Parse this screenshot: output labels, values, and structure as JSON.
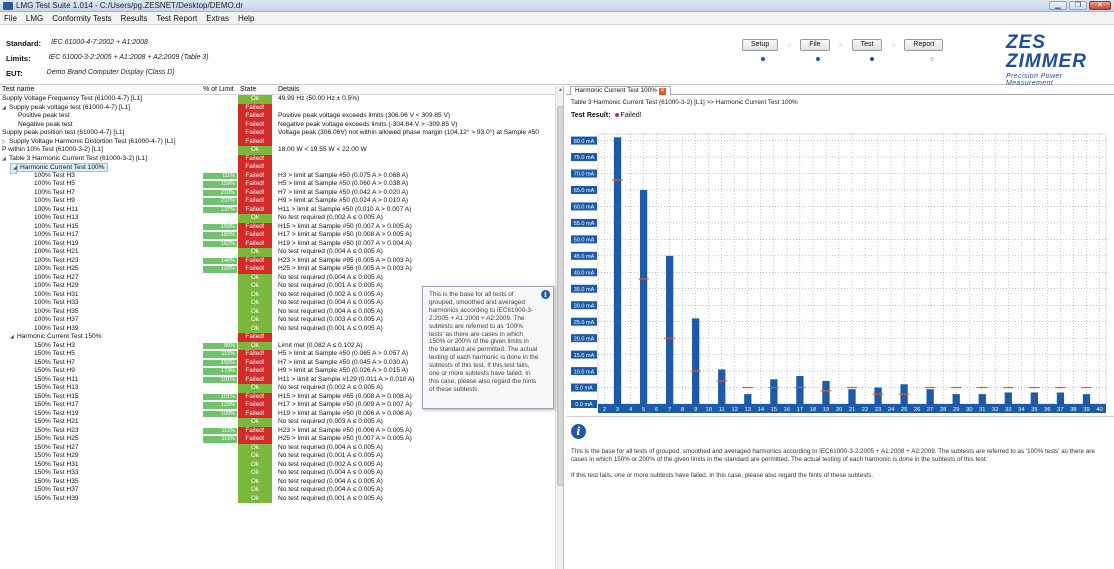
{
  "window": {
    "title": "LMG Test Suite 1.014 - C:/Users/pg.ZESNET/Desktop/DEMO.dr",
    "min": "▁",
    "max": "❐",
    "close": "✕"
  },
  "menu": [
    "File",
    "LMG",
    "Conformity Tests",
    "Results",
    "Test Report",
    "Extras",
    "Help"
  ],
  "header": {
    "standard_label": "Standard:",
    "standard_value": "IEC 61000-4-7:2002 + A1:2008",
    "limits_label": "Limits:",
    "limits_value": "IEC 61000-3-2:2005 + A1:2008 + A2:2009 (Table 3)",
    "eut_label": "EUT:",
    "eut_value": "Demo Brand Computer Display (Class D)"
  },
  "workflow": [
    {
      "label": "Setup",
      "done": true
    },
    {
      "label": "File",
      "done": true
    },
    {
      "label": "Test",
      "done": true
    },
    {
      "label": "Report",
      "done": false
    }
  ],
  "logo": {
    "text": "ZES ZIMMER",
    "subtitle": "Precision Power Measurement"
  },
  "columns": {
    "name": "Test name",
    "limit": "% of Limit",
    "state": "State",
    "details": "Details"
  },
  "rows": [
    {
      "name": "Supply Voltage Frequency Test (61000-4-7) [L1]",
      "indent": 0,
      "state": "Ok",
      "details": "49.99 Hz (50.00 Hz ± 0.5%)"
    },
    {
      "name": "Supply peak voltage test (61000-4-7) [L1]",
      "indent": 0,
      "exp": "◢",
      "state": "Failed!",
      "details": ""
    },
    {
      "name": "Positive peak test",
      "indent": 2,
      "state": "Failed!",
      "details": "Positive peak voltage exceeds limits (306.06 V < 309.85 V)"
    },
    {
      "name": "Negative peak test",
      "indent": 2,
      "state": "Failed!",
      "details": "Negative peak voltage exceeds limits (-304.84 V > -309.85 V)"
    },
    {
      "name": "Supply peak position test (61000-4-7) [L1]",
      "indent": 0,
      "state": "Failed!",
      "details": "Voltage peak (306.06V) not within allowed phase margin (104.12° > 93.0°) at Sample #50"
    },
    {
      "name": "Supply Voltage Harmonic Distortion Test (61000-4-7) [L1]",
      "indent": 0,
      "exp": "▷",
      "state": "Failed!",
      "details": ""
    },
    {
      "name": "P within 10% Test (61000-3-2) [L1]",
      "indent": 0,
      "state": "Ok",
      "details": "18.00 W < 19.55 W < 22.00 W"
    },
    {
      "name": "Table 3 Harmonic Current Test (61000-3-2) [L1]",
      "indent": 0,
      "exp": "◢",
      "state": "Failed!",
      "details": ""
    },
    {
      "name": "Harmonic Current Test 100%",
      "indent": 1,
      "exp": "◢",
      "state": "Failed!",
      "details": "",
      "sel": true
    },
    {
      "name": "100% Test H3",
      "indent": 4,
      "pct": "111%",
      "bw": 34,
      "state": "Failed!",
      "details": "H3 > limit at Sample #50 (0.075 A > 0.068 A)"
    },
    {
      "name": "100% Test H5",
      "indent": 4,
      "pct": "159%",
      "bw": 34,
      "state": "Failed!",
      "details": "H5 > limit at Sample #50 (0.060 A > 0.038 A)"
    },
    {
      "name": "100% Test H7",
      "indent": 4,
      "pct": "210%",
      "bw": 34,
      "state": "Failed!",
      "details": "H7 > limit at Sample #50 (0.042 A > 0.020 A)"
    },
    {
      "name": "100% Test H9",
      "indent": 4,
      "pct": "237%",
      "bw": 34,
      "state": "Failed!",
      "details": "H9 > limit at Sample #50 (0.024 A > 0.010 A)"
    },
    {
      "name": "100% Test H11",
      "indent": 4,
      "pct": "137%",
      "bw": 34,
      "state": "Failed!",
      "details": "H11 > limit at Sample #50 (0.010 A > 0.007 A)"
    },
    {
      "name": "100% Test H13",
      "indent": 4,
      "state": "Ok",
      "details": "No test required (0.002 A ≤ 0.005 A)"
    },
    {
      "name": "100% Test H15",
      "indent": 4,
      "pct": "159%",
      "bw": 34,
      "state": "Failed!",
      "details": "H15 > limit at Sample #50 (0.007 A > 0.005 A)"
    },
    {
      "name": "100% Test H17",
      "indent": 4,
      "pct": "183%",
      "bw": 34,
      "state": "Failed!",
      "details": "H17 > limit at Sample #50 (0.008 A > 0.005 A)"
    },
    {
      "name": "100% Test H19",
      "indent": 4,
      "pct": "162%",
      "bw": 34,
      "state": "Failed!",
      "details": "H19 > limit at Sample #50 (0.007 A > 0.004 A)"
    },
    {
      "name": "100% Test H21",
      "indent": 4,
      "state": "Ok",
      "details": "No test required (0.004 A ≤ 0.005 A)"
    },
    {
      "name": "100% Test H23",
      "indent": 4,
      "pct": "148%",
      "bw": 34,
      "state": "Failed!",
      "details": "H23 > limit at Sample #95 (0.005 A > 0.003 A)"
    },
    {
      "name": "100% Test H25",
      "indent": 4,
      "pct": "168%",
      "bw": 34,
      "state": "Failed!",
      "details": "H25 > limit at Sample #56 (0.005 A > 0.003 A)"
    },
    {
      "name": "100% Test H27",
      "indent": 4,
      "state": "Ok",
      "details": "No test required (0.004 A ≤ 0.005 A)"
    },
    {
      "name": "100% Test H29",
      "indent": 4,
      "state": "Ok",
      "details": "No test required (0.001 A ≤ 0.005 A)"
    },
    {
      "name": "100% Test H31",
      "indent": 4,
      "state": "Ok",
      "details": "No test required (0.002 A ≤ 0.005 A)"
    },
    {
      "name": "100% Test H33",
      "indent": 4,
      "state": "Ok",
      "details": "No test required (0.004 A ≤ 0.005 A)"
    },
    {
      "name": "100% Test H35",
      "indent": 4,
      "state": "Ok",
      "details": "No test required (0.004 A ≤ 0.005 A)"
    },
    {
      "name": "100% Test H37",
      "indent": 4,
      "state": "Ok",
      "details": "No test required (0.003 A ≤ 0.005 A)"
    },
    {
      "name": "100% Test H39",
      "indent": 4,
      "state": "Ok",
      "details": "No test required (0.001 A ≤ 0.005 A)"
    },
    {
      "name": "Harmonic Current Test 150%",
      "indent": 1,
      "exp": "◢",
      "state": "Failed!",
      "details": ""
    },
    {
      "name": "150% Test H3",
      "indent": 4,
      "pct": "80%",
      "bw": 34,
      "state": "Ok",
      "details": "Limit met (0.082 A ≤ 0.102 A)"
    },
    {
      "name": "150% Test H5",
      "indent": 4,
      "pct": "113%",
      "bw": 34,
      "state": "Failed!",
      "details": "H5 > limit at Sample #50 (0.065 A > 0.057 A)"
    },
    {
      "name": "150% Test H7",
      "indent": 4,
      "pct": "150%",
      "bw": 34,
      "state": "Failed!",
      "details": "H7 > limit at Sample #50 (0.045 A > 0.030 A)"
    },
    {
      "name": "150% Test H9",
      "indent": 4,
      "pct": "173%",
      "bw": 34,
      "state": "Failed!",
      "details": "H9 > limit at Sample #50 (0.026 A > 0.015 A)"
    },
    {
      "name": "150% Test H11",
      "indent": 4,
      "pct": "101%",
      "bw": 34,
      "state": "Failed!",
      "details": "H11 > limit at Sample #129 (0.011 A > 0.010 A)"
    },
    {
      "name": "150% Test H13",
      "indent": 4,
      "state": "Ok",
      "details": "No test required (0.002 A ≤ 0.005 A)"
    },
    {
      "name": "150% Test H15",
      "indent": 4,
      "pct": "101%",
      "bw": 34,
      "state": "Failed!",
      "details": "H15 > limit at Sample #65 (0.008 A > 0.008 A)"
    },
    {
      "name": "150% Test H17",
      "indent": 4,
      "pct": "129%",
      "bw": 34,
      "state": "Failed!",
      "details": "H17 > limit at Sample #50 (0.009 A > 0.007 A)"
    },
    {
      "name": "150% Test H19",
      "indent": 4,
      "pct": "100%",
      "bw": 34,
      "state": "Failed!",
      "details": "H19 > limit at Sample #50 (0.006 A > 0.006 A)"
    },
    {
      "name": "150% Test H21",
      "indent": 4,
      "state": "Ok",
      "details": "No test required (0.003 A ≤ 0.005 A)"
    },
    {
      "name": "150% Test H23",
      "indent": 4,
      "pct": "112%",
      "bw": 34,
      "state": "Failed!",
      "details": "H23 > limit at Sample #50 (0.006 A > 0.005 A)"
    },
    {
      "name": "150% Test H25",
      "indent": 4,
      "pct": "112%",
      "bw": 34,
      "state": "Failed!",
      "details": "H25 > limit at Sample #50 (0.007 A > 0.005 A)"
    },
    {
      "name": "150% Test H27",
      "indent": 4,
      "state": "Ok",
      "details": "No test required (0.004 A ≤ 0.005 A)"
    },
    {
      "name": "150% Test H29",
      "indent": 4,
      "state": "Ok",
      "details": "No test required (0.001 A ≤ 0.005 A)"
    },
    {
      "name": "150% Test H31",
      "indent": 4,
      "state": "Ok",
      "details": "No test required (0.002 A ≤ 0.005 A)"
    },
    {
      "name": "150% Test H33",
      "indent": 4,
      "state": "Ok",
      "details": "No test required (0.004 A ≤ 0.005 A)"
    },
    {
      "name": "150% Test H35",
      "indent": 4,
      "state": "Ok",
      "details": "No test required (0.004 A ≤ 0.005 A)"
    },
    {
      "name": "150% Test H37",
      "indent": 4,
      "state": "Ok",
      "details": "No test required (0.004 A ≤ 0.005 A)"
    },
    {
      "name": "150% Test H39",
      "indent": 4,
      "state": "Ok",
      "details": "No test required (0.001 A ≤ 0.005 A)"
    }
  ],
  "tooltip": "This is the base for all tests of grouped, smoothed and averaged harmonics according to IEC61000-3-2:2005 + A1:2008 + A2:2009. The subtests are referred to as '100% tests' as there are cases in which 150% or 200% of the given limits in the standard are permitted. The actual testing of each harmonic is done in the subtests of this test. If this test fails, one or more subtests have failed. In this case, please also regard the hints of these subtests.",
  "right": {
    "tab": "Harmonic Current Test 100%",
    "breadcrumb": "Table 3 Harmonic Current Test (61000-3-2) [L1] >> Harmonic Current Test 100%",
    "result_label": "Test Result:",
    "result_value": "Failed!",
    "info_p1": "This is the base for all tests of grouped, smoothed and averaged harmonics according to IEC61000-3-2:2005 + A1:2008 + A2:2009. The subtests are referred to as '100% tests' as there are cases in which 150% or 200% of the given limits in the standard are permitted. The actual testing of each harmonic is done in the subtests of this test.",
    "info_p2": "If this test fails, one or more subtests have failed. In this case, please also regard the hints of these subtests."
  },
  "colors": {
    "ok": "#79b83a",
    "failed": "#d32a2a",
    "bar": "#1d5aa7",
    "limit": "#e05a2a",
    "pct_bar": "#6dc46d"
  },
  "chart_data": {
    "type": "bar",
    "ylabel_unit": "mA",
    "ylim": [
      0,
      82
    ],
    "yticks": [
      "0.0 mA",
      "5.0 mA",
      "10.0 mA",
      "15.0 mA",
      "20.0 mA",
      "25.0 mA",
      "30.0 mA",
      "35.0 mA",
      "40.0 mA",
      "45.0 mA",
      "50.0 mA",
      "55.0 mA",
      "60.0 mA",
      "65.0 mA",
      "70.0 mA",
      "75.0 mA",
      "80.0 mA"
    ],
    "ytick_values": [
      0,
      5,
      10,
      15,
      20,
      25,
      30,
      35,
      40,
      45,
      50,
      55,
      60,
      65,
      70,
      75,
      80
    ],
    "categories": [
      "2",
      "3",
      "4",
      "5",
      "6",
      "7",
      "8",
      "9",
      "10",
      "11",
      "12",
      "13",
      "14",
      "15",
      "16",
      "17",
      "18",
      "19",
      "20",
      "21",
      "22",
      "23",
      "24",
      "25",
      "26",
      "27",
      "28",
      "29",
      "30",
      "31",
      "32",
      "33",
      "34",
      "35",
      "36",
      "37",
      "38",
      "39",
      "40"
    ],
    "values": [
      0,
      81,
      0,
      65,
      0,
      45,
      0,
      26,
      0,
      10.5,
      0,
      3,
      0,
      7.5,
      0,
      8.5,
      0,
      7,
      0,
      4.5,
      0,
      5,
      0,
      6,
      0,
      4.5,
      0,
      3,
      0,
      3,
      0,
      3.5,
      0,
      3.5,
      0,
      3.5,
      0,
      3,
      0
    ],
    "limits": [
      null,
      68,
      null,
      38,
      null,
      20,
      null,
      10,
      null,
      7,
      null,
      5,
      null,
      5,
      null,
      5,
      null,
      4,
      null,
      5,
      null,
      3,
      null,
      3,
      null,
      5,
      null,
      5,
      null,
      5,
      null,
      5,
      null,
      5,
      null,
      5,
      null,
      5,
      null
    ]
  }
}
